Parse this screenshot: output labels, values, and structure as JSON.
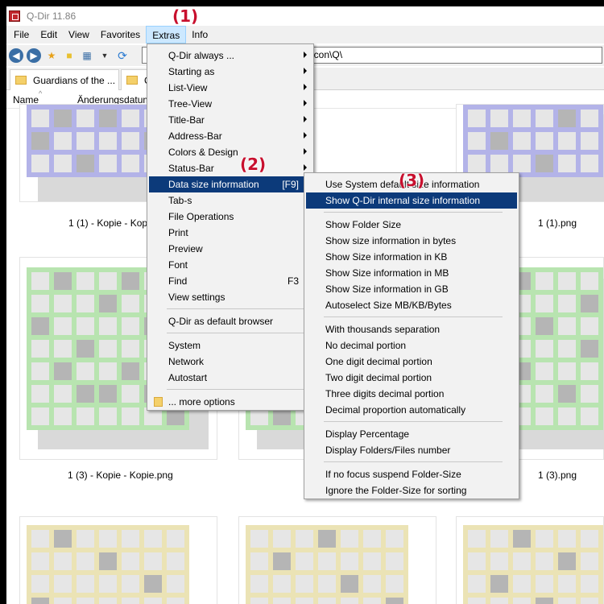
{
  "window": {
    "title": "Q-Dir 11.86"
  },
  "menubar": [
    "File",
    "Edit",
    "View",
    "Favorites",
    "Extras",
    "Info"
  ],
  "address": {
    "value": "...g\\icon\\Q\\"
  },
  "tabs": [
    {
      "label": "Guardians of the ..."
    },
    {
      "label": "C"
    }
  ],
  "columns": {
    "name": "Name",
    "date": "Änderungsdatum"
  },
  "thumbs": [
    {
      "caption": "1 (1) - Kopie - Kopie.png"
    },
    {
      "caption": "1 (1).png"
    },
    {
      "caption": "1 (3) - Kopie - Kopie.png"
    },
    {
      "caption": "1 (3).png"
    }
  ],
  "extras_menu": [
    {
      "label": "Q-Dir always ...",
      "submenu": true
    },
    {
      "label": "Starting as",
      "submenu": true
    },
    {
      "label": "List-View",
      "submenu": true
    },
    {
      "label": "Tree-View",
      "submenu": true
    },
    {
      "label": "Title-Bar",
      "submenu": true
    },
    {
      "label": "Address-Bar",
      "submenu": true
    },
    {
      "label": "Colors & Design",
      "submenu": true
    },
    {
      "label": "Status-Bar",
      "submenu": true
    },
    {
      "label": "Data size information",
      "accel": "[F9]",
      "submenu": true,
      "highlighted": true
    },
    {
      "label": "Tab-s",
      "submenu": true
    },
    {
      "label": "File Operations",
      "submenu": true
    },
    {
      "label": "Print",
      "submenu": true
    },
    {
      "label": "Preview",
      "submenu": true
    },
    {
      "label": "Font",
      "submenu": true
    },
    {
      "label": "Find",
      "accel": "F3",
      "submenu": true
    },
    {
      "label": "View settings",
      "submenu": true
    },
    {
      "label": "Q-Dir as default browser",
      "submenu": true
    },
    {
      "label": "System",
      "submenu": true
    },
    {
      "label": "Network",
      "submenu": true
    },
    {
      "label": "Autostart",
      "submenu": true
    },
    {
      "label": "... more options",
      "submenu": false
    }
  ],
  "size_menu": [
    "Use System default size information",
    "Show Q-Dir internal size information",
    "Show Folder Size",
    "Show size information in bytes",
    "Show Size information in KB",
    "Show Size information in MB",
    "Show Size information in GB",
    "Autoselect Size MB/KB/Bytes",
    "With thousands separation",
    "No decimal portion",
    "One digit decimal portion",
    "Two digit decimal portion",
    "Three digits decimal portion",
    "Decimal proportion automatically",
    "Display Percentage",
    "Display Folders/Files number",
    "If no focus suspend Folder-Size",
    "Ignore the Folder-Size for sorting"
  ],
  "badges": [
    "(1)",
    "(2)",
    "(3)"
  ],
  "colors": {
    "purple": "#b3b3e8",
    "green": "#b8e4b0",
    "yellow": "#ebe3b5",
    "gray": "#b5b5b5",
    "cell": "#e6e6e6",
    "highlight": "#0c3a7a"
  }
}
